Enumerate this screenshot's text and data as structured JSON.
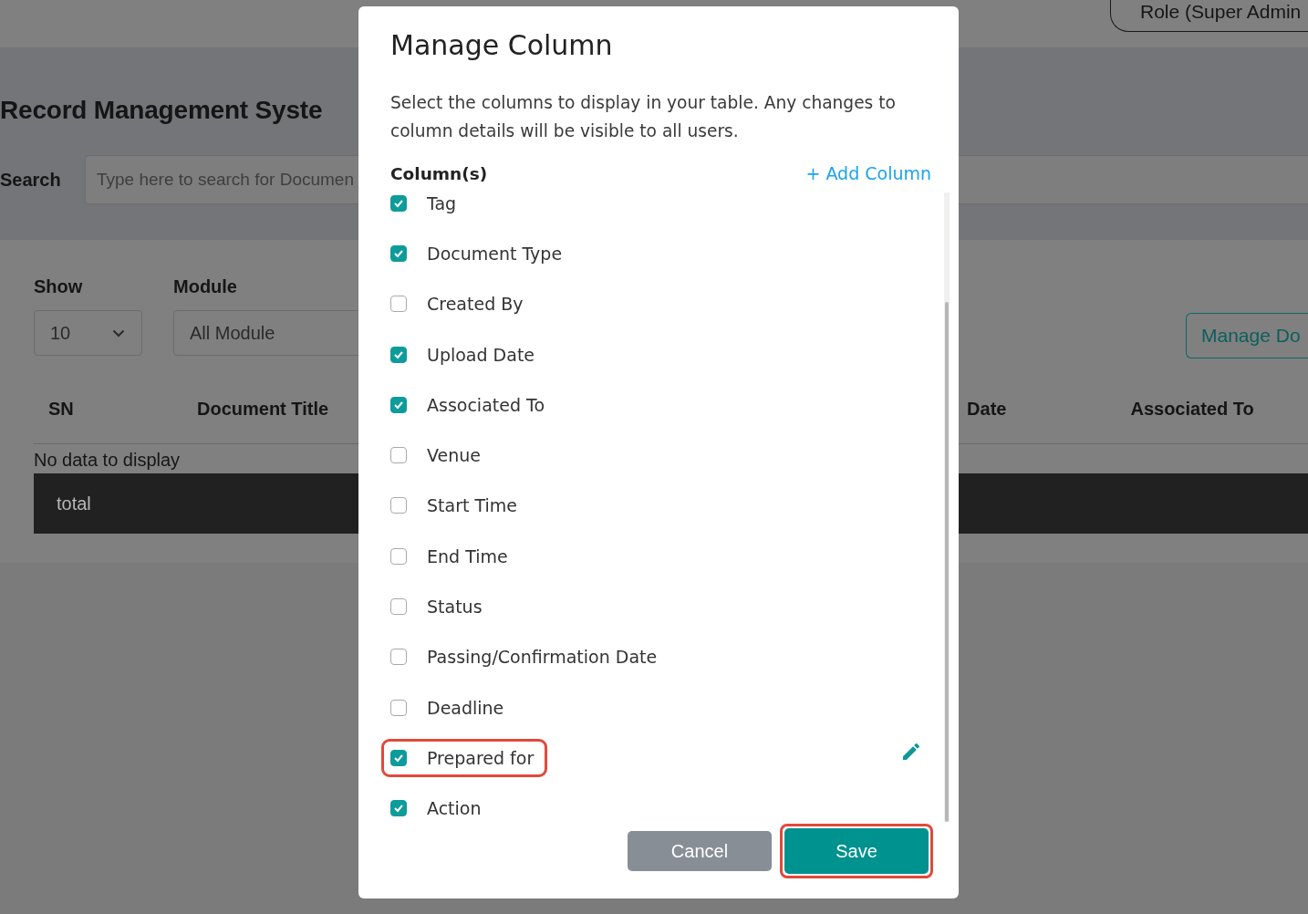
{
  "top_bar": {
    "role_label": "Role (Super Admin"
  },
  "page": {
    "title": "Record Management Syste",
    "search": {
      "label": "Search",
      "placeholder": "Type here to search for Documen"
    },
    "filters": [
      {
        "label": "Show",
        "value": "10",
        "kind": "dropdown"
      },
      {
        "label": "Module",
        "value": "All Module",
        "kind": "field"
      }
    ],
    "manage_button": "Manage Do",
    "table": {
      "columns": [
        "SN",
        "Document Title",
        "Date",
        "Associated To"
      ],
      "empty_text": "No data to display",
      "footer": "total"
    }
  },
  "dialog": {
    "title": "Manage Column",
    "description": "Select the columns to display in your table. Any changes to column details will be visible to all users.",
    "section_label": "Column(s)",
    "add_link": "+ Add Column",
    "columns": [
      {
        "label": "Tag",
        "checked": true,
        "highlighted": false,
        "editable": false
      },
      {
        "label": "Document Type",
        "checked": true,
        "highlighted": false,
        "editable": false
      },
      {
        "label": "Created By",
        "checked": false,
        "highlighted": false,
        "editable": false
      },
      {
        "label": "Upload Date",
        "checked": true,
        "highlighted": false,
        "editable": false
      },
      {
        "label": "Associated To",
        "checked": true,
        "highlighted": false,
        "editable": false
      },
      {
        "label": "Venue",
        "checked": false,
        "highlighted": false,
        "editable": false
      },
      {
        "label": "Start Time",
        "checked": false,
        "highlighted": false,
        "editable": false
      },
      {
        "label": "End Time",
        "checked": false,
        "highlighted": false,
        "editable": false
      },
      {
        "label": "Status",
        "checked": false,
        "highlighted": false,
        "editable": false
      },
      {
        "label": "Passing/Confirmation Date",
        "checked": false,
        "highlighted": false,
        "editable": false
      },
      {
        "label": "Deadline",
        "checked": false,
        "highlighted": false,
        "editable": false
      },
      {
        "label": "Prepared for",
        "checked": true,
        "highlighted": true,
        "editable": true
      },
      {
        "label": "Action",
        "checked": true,
        "highlighted": false,
        "editable": false
      }
    ],
    "buttons": [
      {
        "label": "Cancel",
        "kind": "secondary",
        "highlighted": false
      },
      {
        "label": "Save",
        "kind": "primary",
        "highlighted": true
      }
    ]
  }
}
